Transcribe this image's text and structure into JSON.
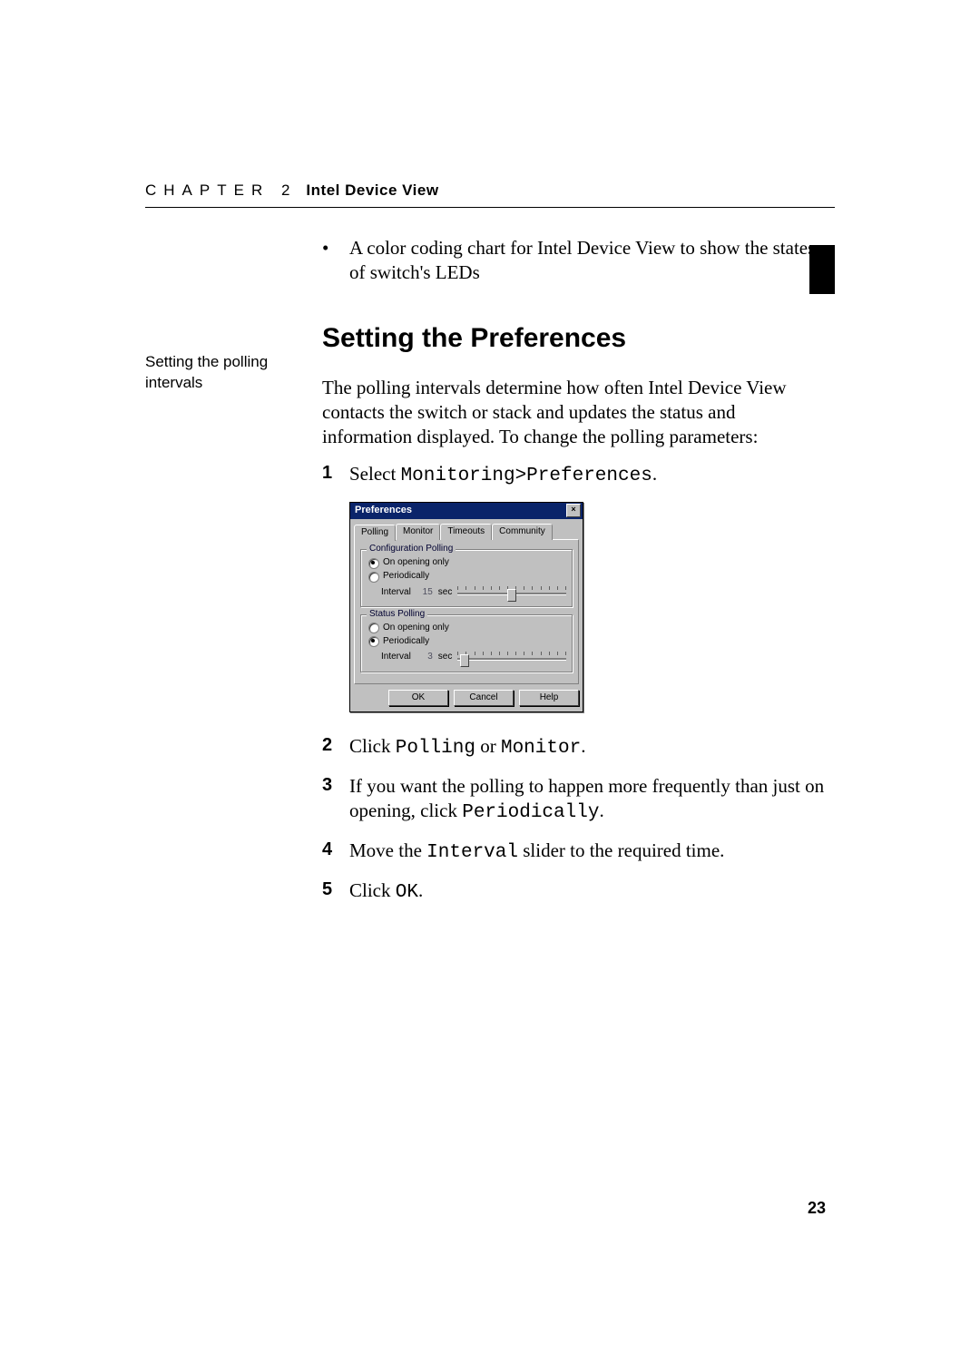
{
  "header": {
    "chapter_label": "CHAPTER 2",
    "chapter_title": "Intel Device View"
  },
  "bullet": {
    "text": "A color coding chart for Intel Device View to show the states of switch's LEDs"
  },
  "section_heading": "Setting the Preferences",
  "sidenote": "Setting the polling intervals",
  "intro_para": "The polling intervals determine how often Intel Device View contacts the switch or stack and updates the status and information displayed. To change the polling parameters:",
  "steps": {
    "s1_pre": "Select ",
    "s1_code": "Monitoring>Preferences",
    "s1_post": ".",
    "s2_pre": "Click ",
    "s2_code1": "Polling",
    "s2_mid": " or ",
    "s2_code2": "Monitor",
    "s2_post": ".",
    "s3_pre": "If you want the polling to happen more frequently than just on opening, click ",
    "s3_code": "Periodically",
    "s3_post": ".",
    "s4_pre": "Move the ",
    "s4_code": "Interval",
    "s4_post": " slider to the required time.",
    "s5_pre": "Click ",
    "s5_code": "OK",
    "s5_post": "."
  },
  "dialog": {
    "title": "Preferences",
    "tabs": [
      "Polling",
      "Monitor",
      "Timeouts",
      "Community"
    ],
    "group1": {
      "label": "Configuration Polling",
      "radio1": "On opening only",
      "radio2": "Periodically",
      "interval_label": "Interval",
      "interval_value": "15",
      "interval_unit": "sec"
    },
    "group2": {
      "label": "Status Polling",
      "radio1": "On opening only",
      "radio2": "Periodically",
      "interval_label": "Interval",
      "interval_value": "3",
      "interval_unit": "sec"
    },
    "buttons": {
      "ok": "OK",
      "cancel": "Cancel",
      "help": "Help"
    }
  },
  "page_number": "23"
}
